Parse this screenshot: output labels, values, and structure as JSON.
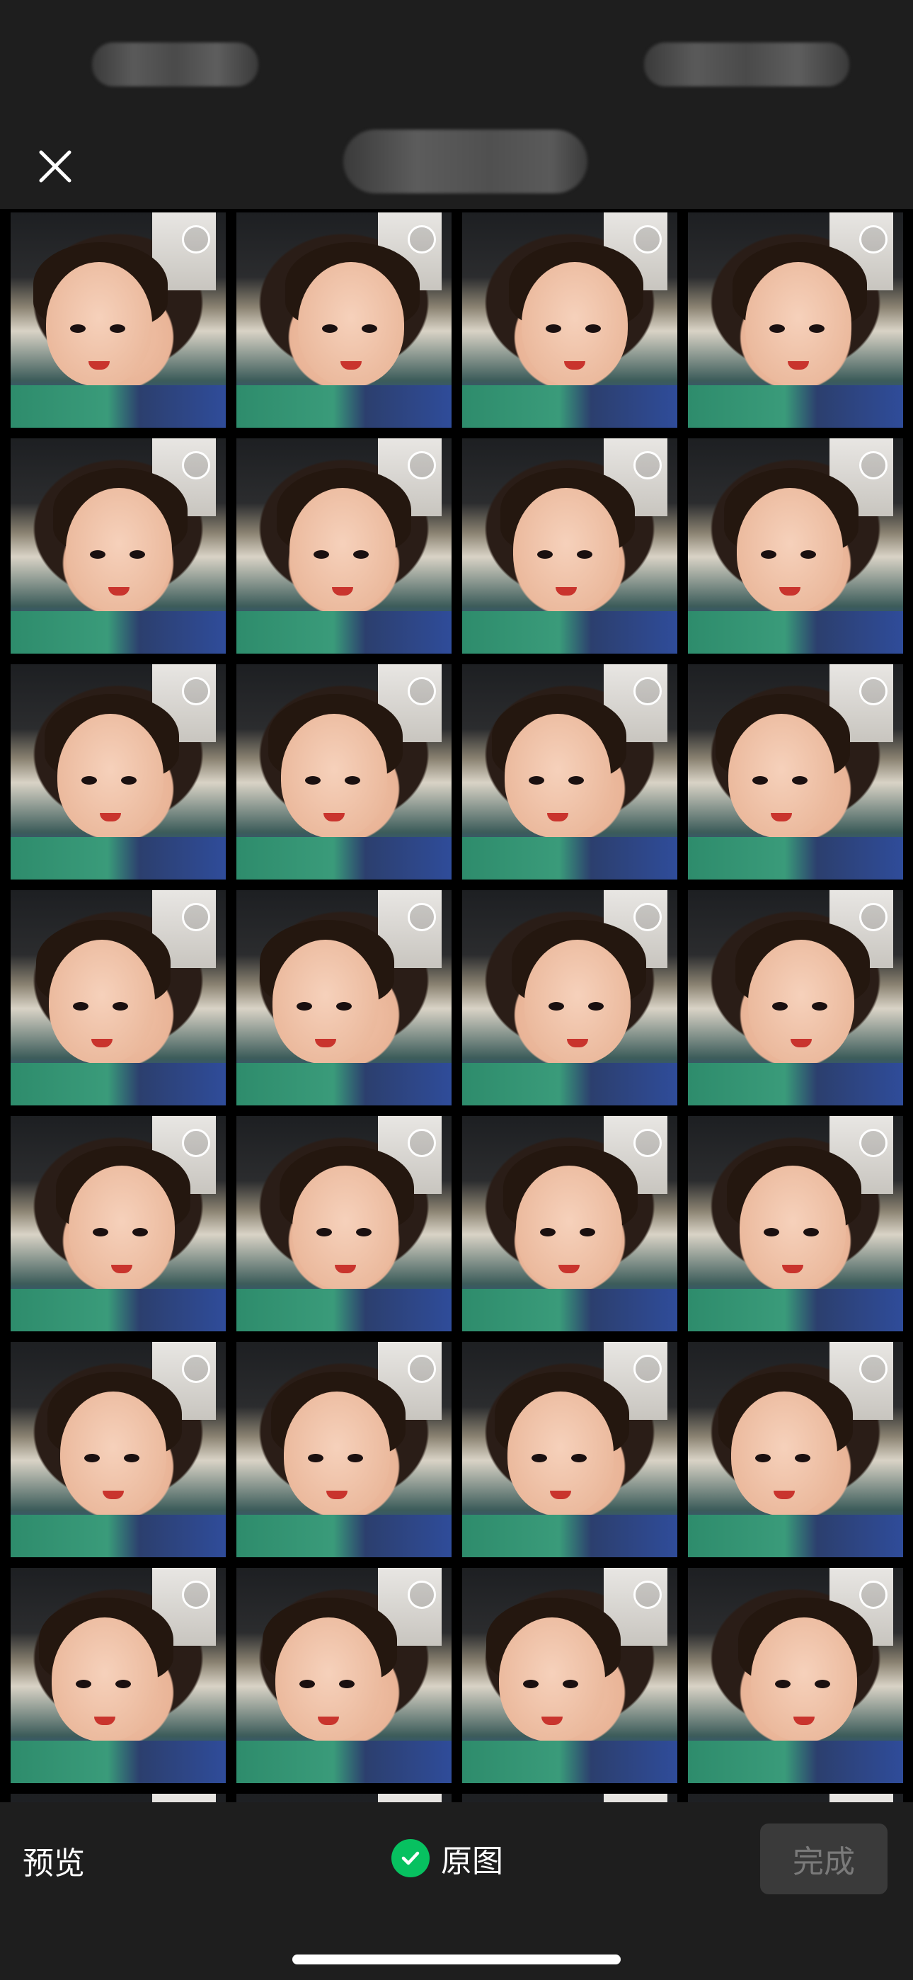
{
  "status_bar": {
    "time_blurred": "",
    "indicators_blurred": ""
  },
  "nav": {
    "close_icon": "close-icon",
    "album_title_blurred": ""
  },
  "grid": {
    "rows": 7,
    "columns": 4,
    "photos": [
      {
        "selected": false
      },
      {
        "selected": false
      },
      {
        "selected": false
      },
      {
        "selected": false
      },
      {
        "selected": false
      },
      {
        "selected": false
      },
      {
        "selected": false
      },
      {
        "selected": false
      },
      {
        "selected": false
      },
      {
        "selected": false
      },
      {
        "selected": false
      },
      {
        "selected": false
      },
      {
        "selected": false
      },
      {
        "selected": false
      },
      {
        "selected": false
      },
      {
        "selected": false
      },
      {
        "selected": false
      },
      {
        "selected": false
      },
      {
        "selected": false
      },
      {
        "selected": false
      },
      {
        "selected": false
      },
      {
        "selected": false
      },
      {
        "selected": false
      },
      {
        "selected": false
      },
      {
        "selected": false
      },
      {
        "selected": false
      },
      {
        "selected": false
      },
      {
        "selected": false
      }
    ]
  },
  "bottom_bar": {
    "preview_label": "预览",
    "original_label": "原图",
    "original_checked": true,
    "done_label": "完成",
    "done_enabled": false
  },
  "colors": {
    "bar_background": "#1e1e1e",
    "accent_green": "#07c160",
    "done_disabled_bg": "#3a3a3a",
    "done_disabled_text": "#7a7a7a"
  }
}
